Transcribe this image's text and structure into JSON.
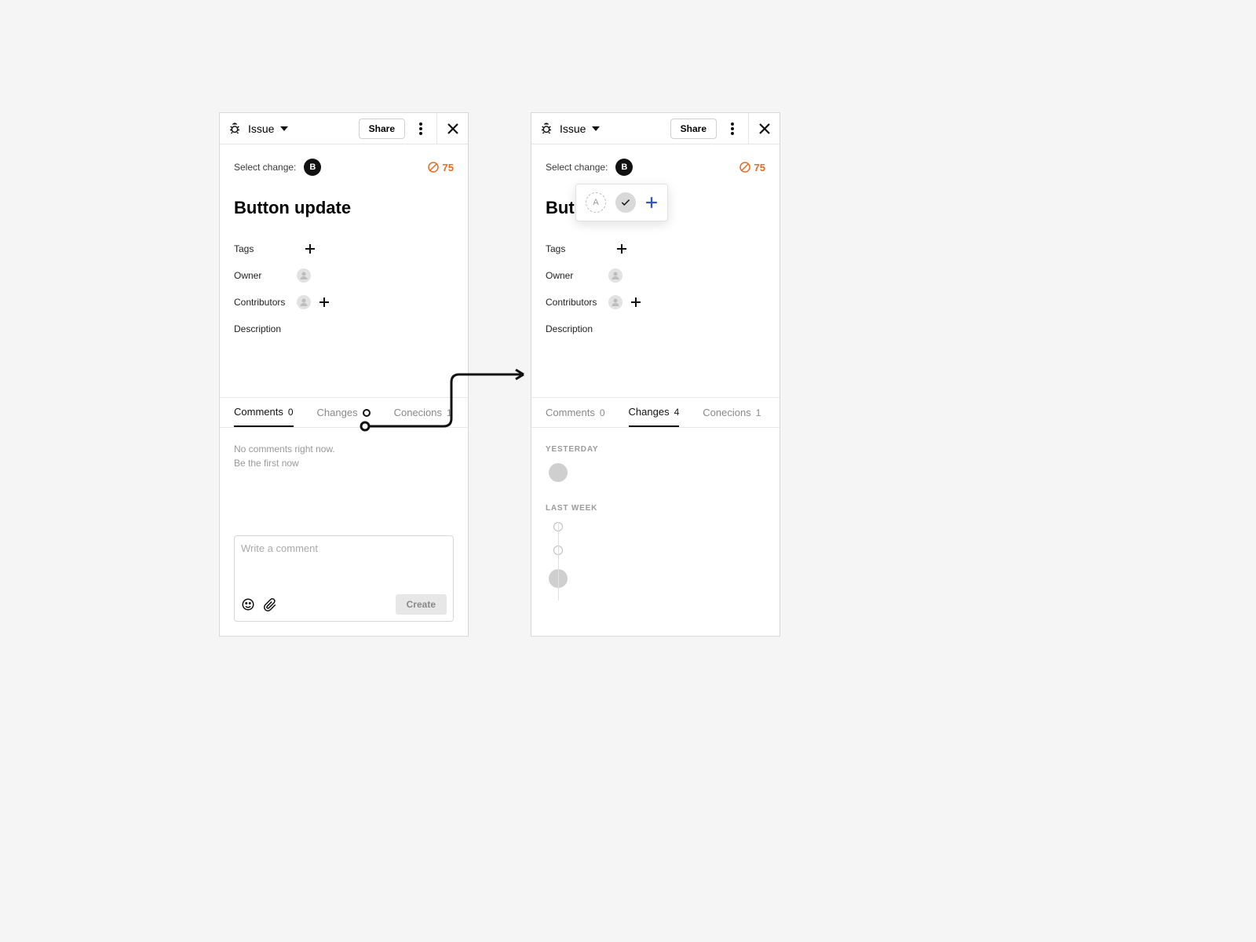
{
  "header": {
    "type_label": "Issue",
    "share": "Share"
  },
  "select": {
    "label": "Select change:",
    "chip": "B",
    "score": "75"
  },
  "title": "Button update",
  "title_cut": "But",
  "meta": {
    "tags": "Tags",
    "owner": "Owner",
    "contributors": "Contributors",
    "description": "Description"
  },
  "tabs": {
    "comments": "Comments",
    "comments_count": "0",
    "changes": "Changes",
    "changes_count_right": "4",
    "connections": "Conecions",
    "connections_count": "1"
  },
  "comments_empty": {
    "line1": "No comments right now.",
    "line2": "Be the first now"
  },
  "comment_box": {
    "placeholder": "Write a comment",
    "create": "Create"
  },
  "changes_view": {
    "yesterday": "YESTERDAY",
    "last_week": "LAST WEEK"
  },
  "popover": {
    "a": "A"
  }
}
